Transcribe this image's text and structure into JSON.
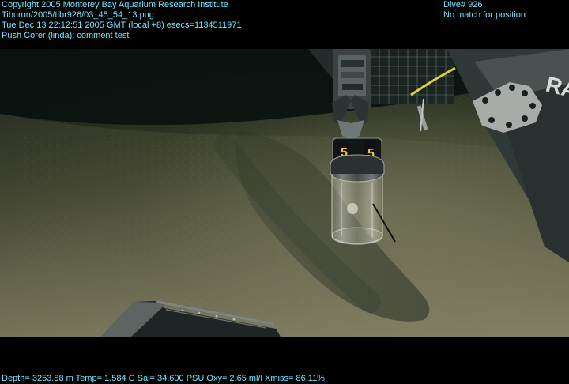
{
  "overlay": {
    "top_left": {
      "line1": "Copyright 2005 Monterey Bay Aquarium Research Institute",
      "line2": "Tiburon/2005/tibr926/03_45_54_13.png",
      "line3": "Tue Dec 13 22:12:51 2005 GMT (local +8)  esecs=1134511971",
      "line4": "Push Corer (linda): comment test"
    },
    "top_right": {
      "line1": "Dive# 926",
      "line2": "No match for position"
    },
    "bottom": {
      "telemetry": "Depth= 3253.88 m  Temp= 1.584 C  Sal= 34.600 PSU  Oxy= 2.65 ml/l  Xmiss= 86.11%"
    }
  },
  "scene": {
    "core_labels": [
      "5",
      "5"
    ],
    "vehicle_panel_text": "RA"
  },
  "colors": {
    "overlay_text": "#6fe7ff"
  }
}
